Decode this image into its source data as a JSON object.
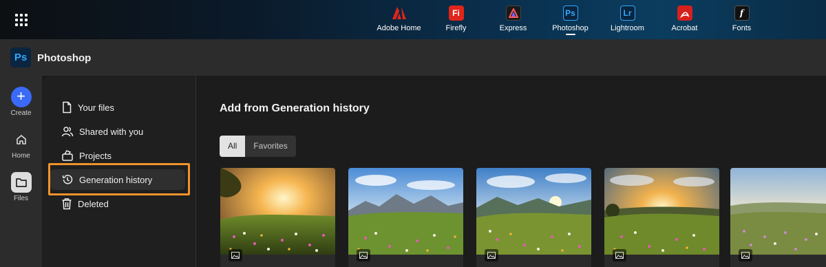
{
  "topbar": {
    "apps": [
      {
        "label": "Adobe Home",
        "icon": "adobe-icon",
        "color": "#e1251b",
        "glyph": "A"
      },
      {
        "label": "Firefly",
        "icon": "firefly-icon",
        "color": "#e1251b",
        "glyph": "Fi"
      },
      {
        "label": "Express",
        "icon": "express-icon",
        "color": "#1a1a1a",
        "glyph": "A"
      },
      {
        "label": "Photoshop",
        "icon": "photoshop-icon",
        "color": "#0a2540",
        "glyph": "Ps"
      },
      {
        "label": "Lightroom",
        "icon": "lightroom-icon",
        "color": "#0a2540",
        "glyph": "Lr"
      },
      {
        "label": "Acrobat",
        "icon": "acrobat-icon",
        "color": "#d7201b",
        "glyph": "A"
      },
      {
        "label": "Fonts",
        "icon": "fonts-icon",
        "color": "#111111",
        "glyph": "f"
      }
    ],
    "active_app": "Photoshop"
  },
  "header": {
    "logo": "Ps",
    "title": "Photoshop"
  },
  "rail": {
    "create": "Create",
    "home": "Home",
    "files": "Files"
  },
  "nav": {
    "items": [
      {
        "label": "Your files",
        "icon": "file-icon"
      },
      {
        "label": "Shared with you",
        "icon": "users-icon"
      },
      {
        "label": "Projects",
        "icon": "projects-icon"
      },
      {
        "label": "Generation history",
        "icon": "history-icon"
      },
      {
        "label": "Deleted",
        "icon": "trash-icon"
      }
    ],
    "active": "Generation history"
  },
  "main": {
    "title": "Add from Generation history",
    "filters": [
      "All",
      "Favorites"
    ],
    "active_filter": "All"
  },
  "colors": {
    "accent": "#3a6af7",
    "highlight": "#f0932b",
    "ps_blue": "#31a8ff"
  }
}
